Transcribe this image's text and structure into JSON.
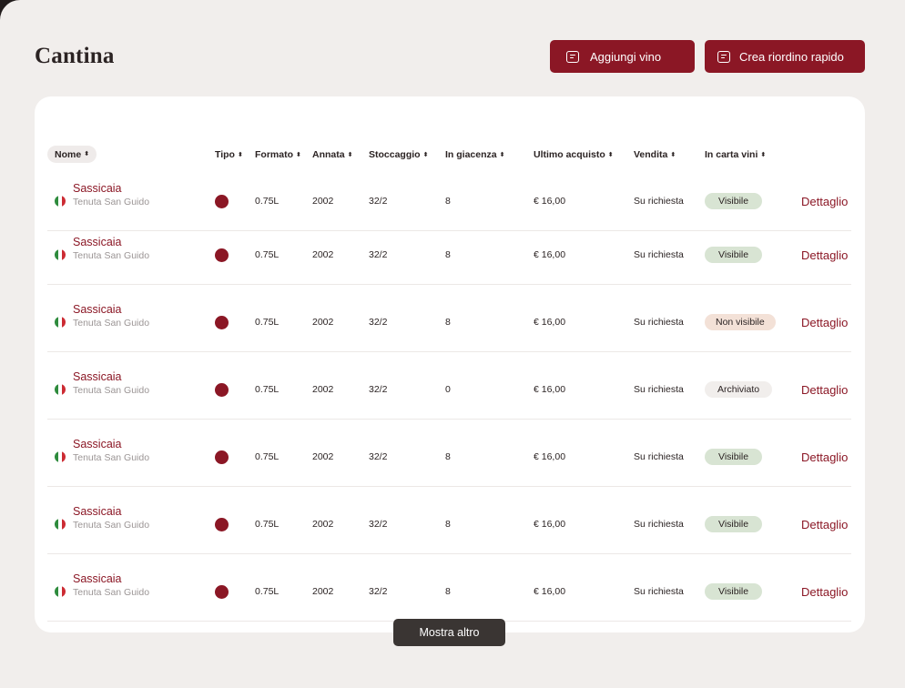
{
  "page": {
    "title": "Cantina"
  },
  "actions": {
    "add_wine": "Aggiungi vino",
    "quick_reorder": "Crea riordino rapido"
  },
  "table": {
    "columns": [
      "Nome",
      "Tipo",
      "Formato",
      "Annata",
      "Stoccaggio",
      "In giacenza",
      "Ultimo acquisto",
      "Vendita",
      "In carta vini"
    ],
    "sort_icon": "⬍",
    "rows": [
      {
        "name": "Sassicaia",
        "producer": "Tenuta San Guido",
        "format": "0.75L",
        "vintage": "2002",
        "storage": "32/2",
        "stock": "8",
        "last_purchase": "€ 16,00",
        "sale": "Su richiesta",
        "wine_list": "Visibile",
        "status": "visible",
        "action": "Dettaglio"
      },
      {
        "name": "Sassicaia",
        "producer": "Tenuta San Guido",
        "format": "0.75L",
        "vintage": "2002",
        "storage": "32/2",
        "stock": "8",
        "last_purchase": "€ 16,00",
        "sale": "Su richiesta",
        "wine_list": "Visibile",
        "status": "visible",
        "action": "Dettaglio"
      },
      {
        "name": "Sassicaia",
        "producer": "Tenuta San Guido",
        "format": "0.75L",
        "vintage": "2002",
        "storage": "32/2",
        "stock": "8",
        "last_purchase": "€ 16,00",
        "sale": "Su richiesta",
        "wine_list": "Non visibile",
        "status": "not-visible",
        "action": "Dettaglio"
      },
      {
        "name": "Sassicaia",
        "producer": "Tenuta San Guido",
        "format": "0.75L",
        "vintage": "2002",
        "storage": "32/2",
        "stock": "0",
        "last_purchase": "€ 16,00",
        "sale": "Su richiesta",
        "wine_list": "Archiviato",
        "status": "archived",
        "action": "Dettaglio"
      },
      {
        "name": "Sassicaia",
        "producer": "Tenuta San Guido",
        "format": "0.75L",
        "vintage": "2002",
        "storage": "32/2",
        "stock": "8",
        "last_purchase": "€ 16,00",
        "sale": "Su richiesta",
        "wine_list": "Visibile",
        "status": "visible",
        "action": "Dettaglio"
      },
      {
        "name": "Sassicaia",
        "producer": "Tenuta San Guido",
        "format": "0.75L",
        "vintage": "2002",
        "storage": "32/2",
        "stock": "8",
        "last_purchase": "€ 16,00",
        "sale": "Su richiesta",
        "wine_list": "Visibile",
        "status": "visible",
        "action": "Dettaglio"
      },
      {
        "name": "Sassicaia",
        "producer": "Tenuta San Guido",
        "format": "0.75L",
        "vintage": "2002",
        "storage": "32/2",
        "stock": "8",
        "last_purchase": "€ 16,00",
        "sale": "Su richiesta",
        "wine_list": "Visibile",
        "status": "visible",
        "action": "Dettaglio"
      }
    ]
  },
  "footer": {
    "show_more": "Mostra altro"
  },
  "colors": {
    "accent": "#8b1725",
    "visible_badge": "#d8e4d3",
    "not_visible_badge": "#f3e1d7",
    "archived_badge": "#f1eeec"
  },
  "icons": {
    "button_icon": "list-card-icon",
    "flag": "italy-flag-icon",
    "wine_type": "red-wine-dot-icon"
  }
}
